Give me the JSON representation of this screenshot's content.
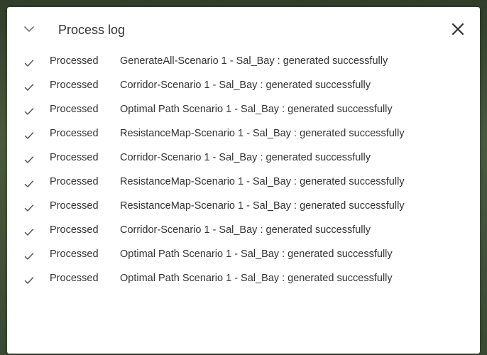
{
  "panel": {
    "title": "Process log",
    "collapse_icon": "chevron-down-icon",
    "close_icon": "close-icon"
  },
  "log": {
    "entries": [
      {
        "status": "Processed",
        "message": "GenerateAll-Scenario 1 - Sal_Bay : generated successfully"
      },
      {
        "status": "Processed",
        "message": "Corridor-Scenario 1 - Sal_Bay : generated successfully"
      },
      {
        "status": "Processed",
        "message": "Optimal Path Scenario 1 - Sal_Bay : generated successfully"
      },
      {
        "status": "Processed",
        "message": "ResistanceMap-Scenario 1 - Sal_Bay : generated successfully"
      },
      {
        "status": "Processed",
        "message": "Corridor-Scenario 1 - Sal_Bay : generated successfully"
      },
      {
        "status": "Processed",
        "message": "ResistanceMap-Scenario 1 - Sal_Bay : generated successfully"
      },
      {
        "status": "Processed",
        "message": "ResistanceMap-Scenario 1 - Sal_Bay : generated successfully"
      },
      {
        "status": "Processed",
        "message": "Corridor-Scenario 1 - Sal_Bay : generated successfully"
      },
      {
        "status": "Processed",
        "message": "Optimal Path Scenario 1 - Sal_Bay : generated successfully"
      },
      {
        "status": "Processed",
        "message": "Optimal Path Scenario 1 - Sal_Bay : generated successfully"
      }
    ]
  }
}
